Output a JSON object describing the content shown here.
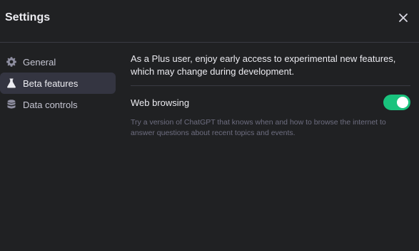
{
  "header": {
    "title": "Settings",
    "close_icon": "close-icon"
  },
  "sidebar": {
    "items": [
      {
        "label": "General",
        "icon": "gear-icon",
        "active": false
      },
      {
        "label": "Beta features",
        "icon": "flask-icon",
        "active": true
      },
      {
        "label": "Data controls",
        "icon": "database-icon",
        "active": false
      }
    ]
  },
  "main": {
    "intro": "As a Plus user, enjoy early access to experimental new features, which may change during development.",
    "features": [
      {
        "title": "Web browsing",
        "enabled": true,
        "description": "Try a version of ChatGPT that knows when and how to browse the internet to answer questions about recent topics and events."
      }
    ]
  },
  "colors": {
    "background": "#202123",
    "active_nav": "#343541",
    "toggle_on": "#19c37d",
    "divider": "#3a3b43"
  }
}
